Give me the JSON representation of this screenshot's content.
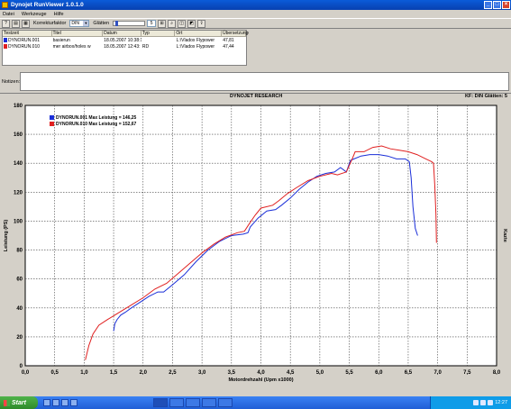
{
  "window": {
    "title": "Dynojet RunViewer 1.0.1.0",
    "controls": {
      "minimize": "_",
      "maximize": "□",
      "close": "×"
    }
  },
  "menu": [
    "Datei",
    "Werkzeuge",
    "Hilfe"
  ],
  "toolbar": {
    "correction_label": "Korrekturfaktor",
    "correction_value": "DIN",
    "smoothing_label": "Glätten",
    "smoothing_value": "5"
  },
  "runlist": {
    "columns": [
      "Testzeit",
      "Titel",
      "Datum",
      "Typ",
      "Ort",
      "Übersetzungen"
    ],
    "rows": [
      {
        "file": "DYNORUN.001",
        "title": "basierun",
        "date": "18.05.2007 10:38:1",
        "type": "",
        "location": "L:\\Vladox Flypower",
        "ratio": "47,81",
        "color": "#1a2ed8"
      },
      {
        "file": "DYNORUN.010",
        "title": "mer airbox/holes w",
        "date": "18.05.2007 12:43:",
        "type": "RD",
        "location": "L:\\Vladox Flypower",
        "ratio": "47,44",
        "color": "#e02020"
      }
    ]
  },
  "notes": {
    "label": "Notizen:",
    "value": ""
  },
  "chart_header": {
    "title": "DYNOJET RESEARCH",
    "info": "KF: DIN  Glätten: 5"
  },
  "chart_data": {
    "type": "line",
    "xlabel": "Motordrehzahl (Upm x1000)",
    "ylabel": "Leistung (PS)",
    "y2label": "Kazte",
    "xlim": [
      0.0,
      8.0
    ],
    "ylim": [
      0,
      180
    ],
    "xticks": [
      "0,0",
      "0,5",
      "1,0",
      "1,5",
      "2,0",
      "2,5",
      "3,0",
      "3,5",
      "4,0",
      "4,5",
      "5,0",
      "5,5",
      "6,0",
      "6,5",
      "7,0",
      "7,5",
      "8,0"
    ],
    "yticks": [
      "0",
      "20",
      "40",
      "60",
      "80",
      "100",
      "120",
      "140",
      "160",
      "180"
    ],
    "grid": true,
    "legend_position": "top-left",
    "series": [
      {
        "name": "DYNORUN.001 Max Leistung = 146,25",
        "color": "#1a2ed8",
        "x": [
          1.5,
          1.52,
          1.56,
          1.62,
          1.7,
          1.8,
          1.95,
          2.1,
          2.25,
          2.35,
          2.5,
          2.7,
          2.9,
          3.1,
          3.3,
          3.5,
          3.7,
          3.78,
          3.82,
          3.95,
          4.1,
          4.25,
          4.35,
          4.5,
          4.65,
          4.8,
          4.95,
          5.1,
          5.25,
          5.35,
          5.45,
          5.52,
          5.58,
          5.7,
          5.85,
          6.0,
          6.15,
          6.3,
          6.45,
          6.52,
          6.55,
          6.58,
          6.62,
          6.66
        ],
        "y": [
          24,
          29,
          32,
          35,
          37,
          40,
          44,
          48,
          51,
          51,
          56,
          63,
          72,
          80,
          86,
          90,
          91,
          92,
          96,
          102,
          107,
          108,
          111,
          116,
          122,
          127,
          131,
          133,
          134,
          137,
          134,
          142,
          143,
          145,
          146,
          146,
          145,
          143,
          143,
          141,
          130,
          110,
          95,
          90
        ]
      },
      {
        "name": "DYNORUN.010 Max Leistung = 152,67",
        "color": "#e02020",
        "x": [
          1.02,
          1.08,
          1.15,
          1.25,
          1.4,
          1.6,
          1.8,
          2.0,
          2.2,
          2.4,
          2.6,
          2.8,
          3.0,
          3.2,
          3.4,
          3.6,
          3.72,
          3.8,
          3.9,
          4.0,
          4.2,
          4.3,
          4.45,
          4.6,
          4.8,
          5.0,
          5.2,
          5.3,
          5.45,
          5.55,
          5.6,
          5.75,
          5.9,
          6.05,
          6.2,
          6.35,
          6.5,
          6.65,
          6.8,
          6.9,
          6.93,
          6.95,
          6.97,
          6.98
        ],
        "y": [
          4,
          14,
          22,
          28,
          32,
          37,
          42,
          47,
          53,
          57,
          64,
          71,
          78,
          84,
          89,
          92,
          93,
          98,
          104,
          109,
          111,
          114,
          119,
          123,
          128,
          131,
          133,
          132,
          134,
          143,
          148,
          148,
          151,
          152,
          150,
          149,
          148,
          146,
          143,
          141,
          140,
          125,
          105,
          85
        ]
      }
    ]
  },
  "taskbar": {
    "start_label": "Start",
    "clock": "12:27"
  }
}
